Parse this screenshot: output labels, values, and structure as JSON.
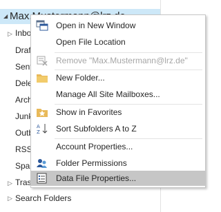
{
  "folder_pane": {
    "account": "Max.Mustermann@lrz.de",
    "folders": [
      "Inbox",
      "Drafts",
      "Sent Items",
      "Deleted Items",
      "Archive",
      "Junk Email",
      "Outbox",
      "RSS Subscriptions",
      "Spam",
      "Trash"
    ],
    "search_folders": "Search Folders"
  },
  "context_menu": {
    "items": [
      {
        "label": "Open in New Window",
        "icon": "new-window-icon"
      },
      {
        "label": "Open File Location",
        "icon": ""
      },
      {
        "label": "Remove \"Max.Mustermann@lrz.de\"",
        "icon": "remove-mailbox-icon",
        "disabled": true
      },
      {
        "label": "New Folder...",
        "icon": "folder-icon"
      },
      {
        "label": "Manage All Site Mailboxes...",
        "icon": ""
      },
      {
        "label": "Show in Favorites",
        "icon": "favorites-star-icon"
      },
      {
        "label": "Sort Subfolders A to Z",
        "icon": "sort-az-icon"
      },
      {
        "label": "Account Properties...",
        "icon": ""
      },
      {
        "label": "Folder Permissions",
        "icon": "permissions-icon"
      },
      {
        "label": "Data File Properties...",
        "icon": "properties-icon",
        "highlighted": true
      }
    ]
  },
  "colors": {
    "account_highlight": "#cde8f8",
    "menu_hover": "#c6c6c6",
    "disabled_text": "#a6a6a6"
  }
}
